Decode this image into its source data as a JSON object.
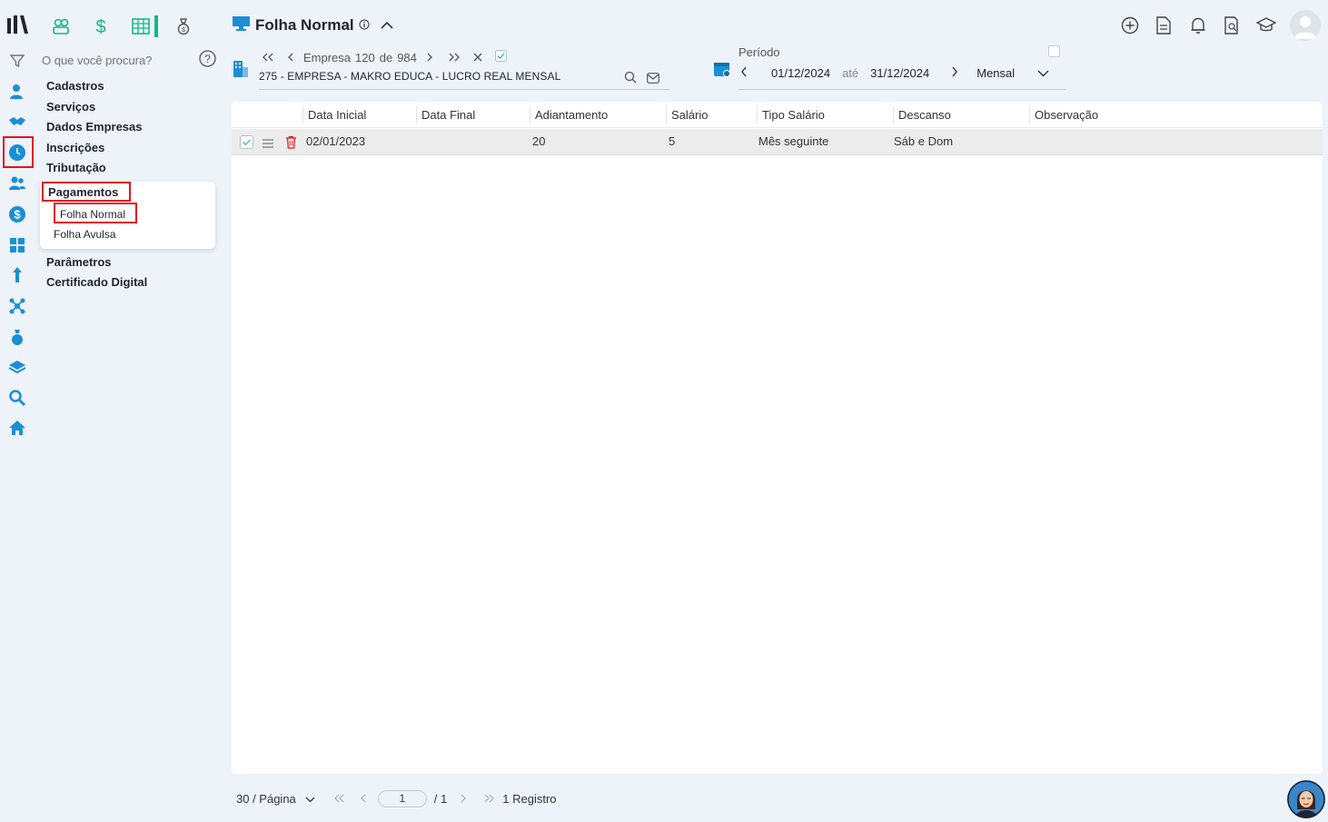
{
  "search": {
    "placeholder": "O que você procura?"
  },
  "sidebar": {
    "items": [
      {
        "label": "Cadastros"
      },
      {
        "label": "Serviços"
      },
      {
        "label": "Dados Empresas"
      },
      {
        "label": "Inscrições"
      },
      {
        "label": "Tributação"
      }
    ],
    "pagamentos": {
      "label": "Pagamentos",
      "sub": [
        {
          "label": "Folha Normal"
        },
        {
          "label": "Folha Avulsa"
        }
      ]
    },
    "items2": [
      {
        "label": "Parâmetros"
      },
      {
        "label": "Certificado Digital"
      }
    ]
  },
  "header": {
    "title": "Folha Normal"
  },
  "company": {
    "nav_label": "Empresa",
    "index": "120",
    "of_label": "de",
    "total": "984",
    "name": "275 - EMPRESA - MAKRO EDUCA - LUCRO REAL MENSAL"
  },
  "period": {
    "label": "Período",
    "start": "01/12/2024",
    "until": "até",
    "end": "31/12/2024",
    "mode": "Mensal"
  },
  "table": {
    "columns": [
      "Data Inicial",
      "Data Final",
      "Adiantamento",
      "Salário",
      "Tipo Salário",
      "Descanso",
      "Observação"
    ],
    "rows": [
      {
        "data_inicial": "02/01/2023",
        "data_final": "",
        "adiantamento": "20",
        "salario": "5",
        "tipo_salario": "Mês seguinte",
        "descanso": "Sáb e Dom",
        "observacao": ""
      }
    ]
  },
  "footer": {
    "per_page": "30 / Página",
    "page": "1",
    "total_pages": "/ 1",
    "records": "1 Registro"
  },
  "colors": {
    "accent": "#1a8fd6",
    "green": "#12b886",
    "highlight": "#e0141e",
    "navy": "#1d2433"
  }
}
